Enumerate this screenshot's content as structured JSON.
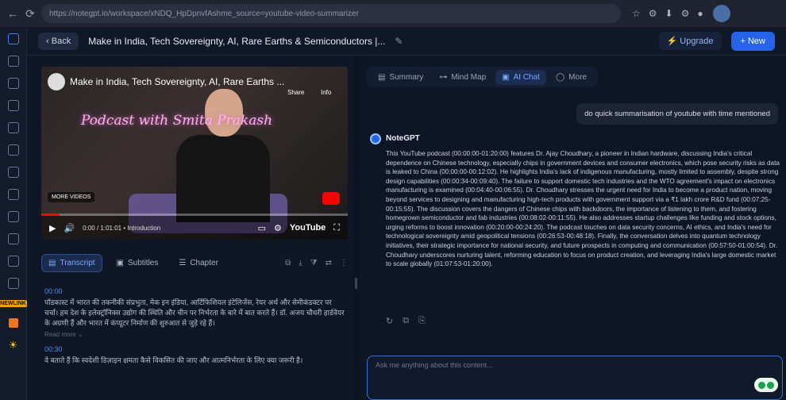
{
  "browser": {
    "url": "https://notegpt.io/workspace/xNDQ_HpDpnvfAshme_source=youtube-video-summarizer",
    "nav_back": "←",
    "nav_reload": "⟳"
  },
  "rail": {
    "badge": "NEWLINK"
  },
  "header": {
    "back_label": "Back",
    "title": "Make in India, Tech Sovereignty, AI, Rare Earths & Semiconductors |...",
    "upgrade_label": "Upgrade",
    "new_label": "+ New"
  },
  "video": {
    "title": "Make in India, Tech Sovereignty, AI, Rare Earths ...",
    "neon_text": "Podcast with Smita Prakash",
    "share_label": "Share",
    "info_label": "Info",
    "more_videos_label": "MORE VIDEOS",
    "time_label": "0:00 / 1:01:01 • Introduction",
    "youtube_label": "YouTube",
    "progress": 0.06
  },
  "left_tabs": [
    {
      "label": "Transcript",
      "icon": "transcript-icon"
    },
    {
      "label": "Subtitles",
      "icon": "subtitles-icon"
    },
    {
      "label": "Chapter",
      "icon": "chapter-icon"
    }
  ],
  "transcript": [
    {
      "time": "00:00",
      "text": "पॉडकास्ट में भारत की तकनीकी संप्रभुता, मेक इन इंडिया, आर्टिफिशियल इंटेलिजेंस, रेयर अर्थ और सेमीकंडक्टर पर चर्चा। हम देश के इलेक्ट्रॉनिक्स उद्योग की स्थिति और चीन पर निर्भरता के बारे में बात करते हैं। डॉ. अजय चौधरी हार्डवेयर के अग्रणी हैं और भारत में कंप्यूटर निर्माण की शुरुआत से जुड़े रहे हैं।",
      "more": "Read more ⌄"
    },
    {
      "time": "00:30",
      "text": "वे बताते हैं कि स्वदेशी डिज़ाइन क्षमता कैसे विकसित की जाए और आत्मनिर्भरता के लिए क्या जरूरी है।"
    }
  ],
  "right_tabs": [
    {
      "label": "Summary",
      "icon": "summary-icon"
    },
    {
      "label": "Mind Map",
      "icon": "mindmap-icon"
    },
    {
      "label": "AI Chat",
      "icon": "chat-icon"
    },
    {
      "label": "More",
      "icon": "more-icon"
    }
  ],
  "chat": {
    "user_message": "do quick summarisation of youtube with time mentioned",
    "bot_name": "NoteGPT",
    "bot_message": "This YouTube podcast (00:00:00-01:20:00) features Dr. Ajay Choudhary, a pioneer in Indian hardware, discussing India's critical dependence on Chinese technology, especially chips in government devices and consumer electronics, which pose security risks as data is leaked to China (00:00:00-00:12:02). He highlights India's lack of indigenous manufacturing, mostly limited to assembly, despite strong design capabilities (00:00:34-00:09:40). The failure to support domestic tech industries and the WTO agreement's impact on electronics manufacturing is examined (00:04:40-00:06:55). Dr. Choudhary stresses the urgent need for India to become a product nation, moving beyond services to designing and manufacturing high-tech products with government support via a ₹1 lakh crore R&D fund (00:07:25-00:15:55). The discussion covers the dangers of Chinese chips with backdoors, the importance of listening to them, and fostering homegrown semiconductor and fab industries (00:08:02-00:11:55). He also addresses startup challenges like funding and stock options, urging reforms to boost innovation (00:20:00-00:24:20). The podcast touches on data security concerns, AI ethics, and India's need for technological sovereignty amid geopolitical tensions (00:26:53-00:48:18). Finally, the conversation delves into quantum technology initiatives, their strategic importance for national security, and future prospects in computing and communication (00:57:50-01:00:54). Dr. Choudhary underscores nurturing talent, reforming education to focus on product creation, and leveraging India's large domestic market to scale globally (01:07:53-01:20:00).",
    "input_placeholder": "Ask me anything about this content..."
  }
}
